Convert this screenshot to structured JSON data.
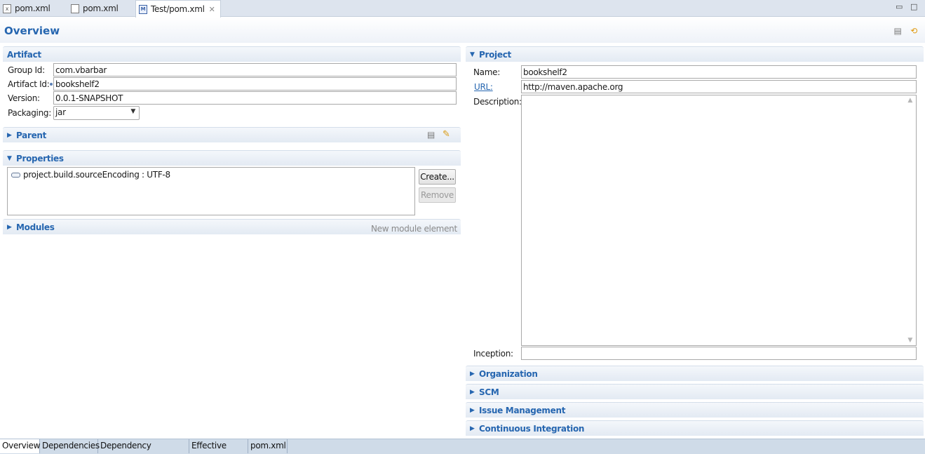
{
  "editor_tabs": [
    {
      "label": "pom.xml"
    },
    {
      "label": "pom.xml"
    },
    {
      "label": "Test/pom.xml",
      "close": "✕"
    }
  ],
  "form": {
    "title": "Overview"
  },
  "artifact": {
    "section_title": "Artifact",
    "group_id_label": "Group Id:",
    "group_id": "com.vbarbar",
    "artifact_id_label": "Artifact Id:",
    "artifact_id": "bookshelf2",
    "version_label": "Version:",
    "version": "0.0.1-SNAPSHOT",
    "packaging_label": "Packaging:",
    "packaging": "jar"
  },
  "parent": {
    "section_title": "Parent"
  },
  "properties": {
    "section_title": "Properties",
    "items": [
      "project.build.sourceEncoding : UTF-8"
    ],
    "create_label": "Create...",
    "remove_label": "Remove"
  },
  "modules": {
    "section_title": "Modules",
    "hint": "New module element"
  },
  "project": {
    "section_title": "Project",
    "name_label": "Name:",
    "name": "bookshelf2",
    "url_label": "URL:",
    "url": "http://maven.apache.org",
    "description_label": "Description:",
    "description": "",
    "inception_label": "Inception:",
    "inception": ""
  },
  "collapsed_sections": [
    "Organization",
    "SCM",
    "Issue Management",
    "Continuous Integration"
  ],
  "page_tabs": [
    "Overview",
    "Dependencies",
    "Dependency Hierarchy",
    "Effective POM",
    "pom.xml"
  ]
}
